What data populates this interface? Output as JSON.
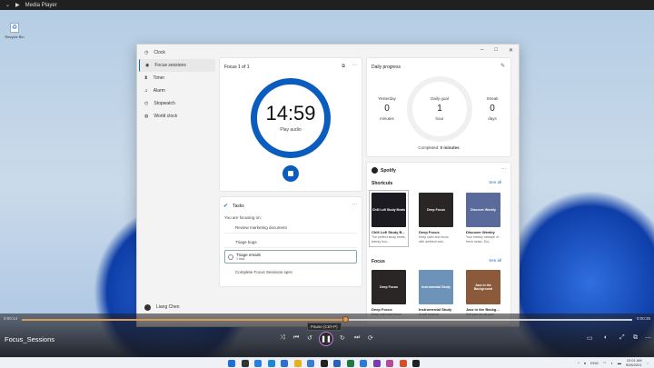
{
  "player": {
    "title": "Media Player",
    "video_title": "Focus_Sessions",
    "elapsed": "0:00:14",
    "remaining": "0:00:35",
    "progress_percent": 53,
    "tooltip": "Pause (Ctrl+P)",
    "accent": "#e09a58"
  },
  "desktop": {
    "recycle_bin": "Recycle Bin"
  },
  "clock": {
    "app_title": "Clock",
    "sidebar": [
      {
        "label": "Focus sessions",
        "icon": "focus-icon"
      },
      {
        "label": "Timer",
        "icon": "hourglass-icon"
      },
      {
        "label": "Alarm",
        "icon": "bell-icon"
      },
      {
        "label": "Stopwatch",
        "icon": "stopwatch-icon"
      },
      {
        "label": "World clock",
        "icon": "globe-icon"
      }
    ],
    "user": "Liang Chen",
    "focus": {
      "title": "Focus 1 of 1",
      "time": "14:59",
      "audio": "Play audio",
      "accent": "#0b5cbf"
    },
    "tasks": {
      "title": "Tasks",
      "subtitle": "You are focusing on:",
      "items": [
        {
          "label": "Review marketing document",
          "note": ""
        },
        {
          "label": "Triage bugs",
          "note": ""
        },
        {
          "label": "Triage emails",
          "note": "1 task",
          "selected": true
        },
        {
          "label": "Complete Focus Sessions spec",
          "note": ""
        }
      ]
    },
    "daily": {
      "title": "Daily progress",
      "yesterday": {
        "label": "Yesterday",
        "value": "0",
        "unit": "minutes"
      },
      "goal": {
        "label": "Daily goal",
        "value": "1",
        "unit": "hour"
      },
      "streak": {
        "label": "Streak",
        "value": "0",
        "unit": "days"
      },
      "completed_label": "Completed:",
      "completed_value": "0 minutes"
    },
    "spotify": {
      "title": "Spotify",
      "shortcuts": "Shortcuts",
      "focus": "Focus",
      "see_all": "See all",
      "shortcut_tiles": [
        {
          "art": "Chill Lofi Study Beats",
          "name": "Chill Lofi Study B...",
          "desc": "The perfect study beats, twenty four...",
          "bg": "#1d1b22"
        },
        {
          "art": "Deep Focus",
          "name": "Deep Focus",
          "desc": "Keep calm and focus with ambient and...",
          "bg": "#2a2626"
        },
        {
          "art": "Discover Weekly",
          "name": "Discover Weekly",
          "desc": "Your weekly mixtape of fresh music. Enj...",
          "bg": "#5a6a9a"
        }
      ],
      "focus_tiles": [
        {
          "art": "Deep Focus",
          "name": "Deep Focus",
          "desc": "Keep calm and focus",
          "bg": "#2a2626"
        },
        {
          "art": "Instrumental Study",
          "name": "Instrumental Study",
          "desc": "A soft musical",
          "bg": "#6d93b8"
        },
        {
          "art": "Jazz in the Background",
          "name": "Jazz in the Backg...",
          "desc": "Soft jazz for all your",
          "bg": "#8a5a3a"
        }
      ]
    }
  },
  "taskbar": {
    "time": "10:01 AM",
    "date": "9/28/2021",
    "lang": "ENG"
  }
}
